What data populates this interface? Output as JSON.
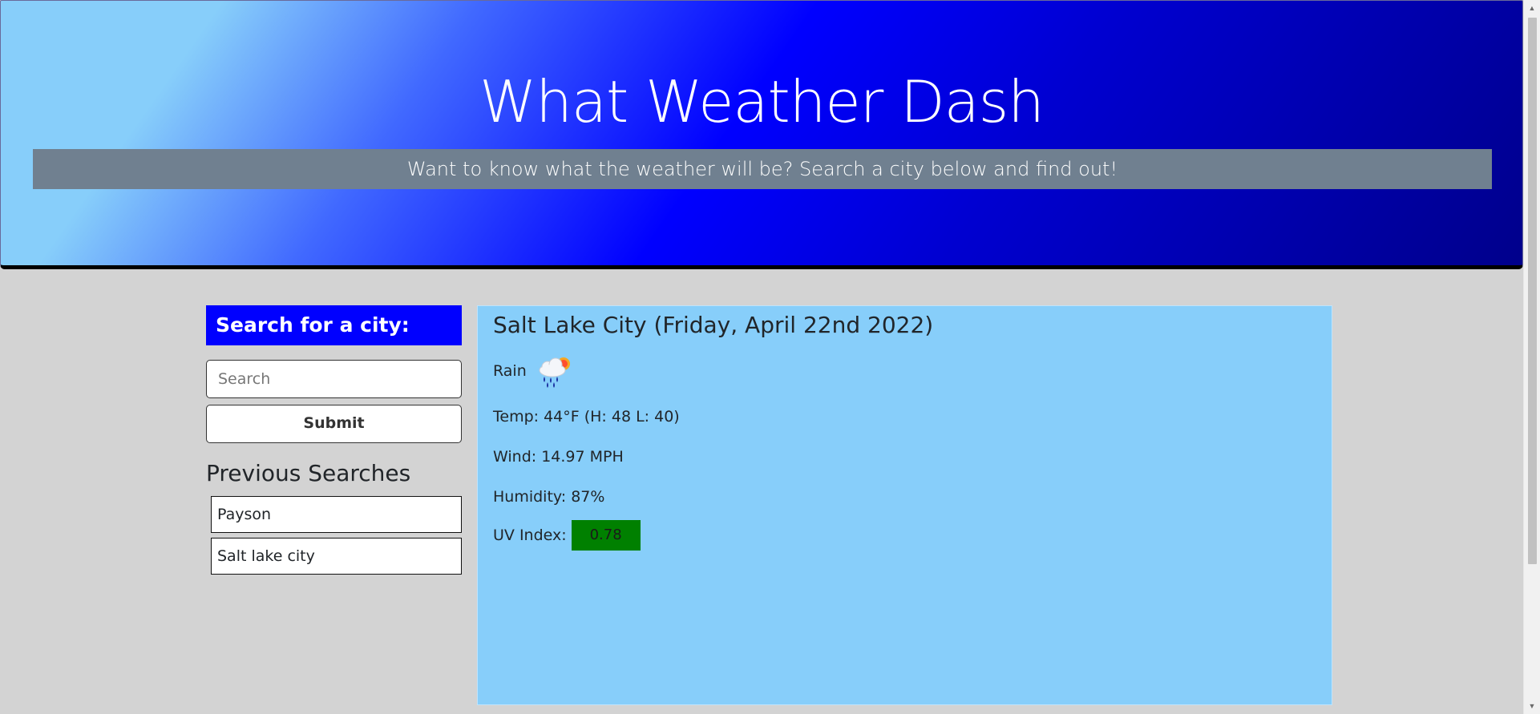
{
  "header": {
    "title": "What Weather Dash",
    "subtitle": "Want to know what the weather will be? Search a city below and find out!"
  },
  "search": {
    "heading": "Search for a city:",
    "placeholder": "Search",
    "submit_label": "Submit"
  },
  "previous": {
    "heading": "Previous Searches",
    "items": [
      "Payson",
      "Salt lake city"
    ]
  },
  "current": {
    "title": "Salt Lake City (Friday, April 22nd 2022)",
    "condition": "Rain",
    "icon": "rain-cloud-sun-icon",
    "temp": "Temp: 44°F (H: 48 L: 40)",
    "wind": "Wind: 14.97 MPH",
    "humidity": "Humidity: 87%",
    "uv_label": "UV Index:",
    "uv_value": "0.78",
    "uv_color": "#008000"
  },
  "colors": {
    "header_gradient_start": "#87cefa",
    "header_gradient_end": "#00008b",
    "subtitle_bar": "#708090",
    "search_heading_bg": "#0000ff",
    "panel_bg": "#87cefa",
    "page_bg": "#d3d3d3"
  }
}
